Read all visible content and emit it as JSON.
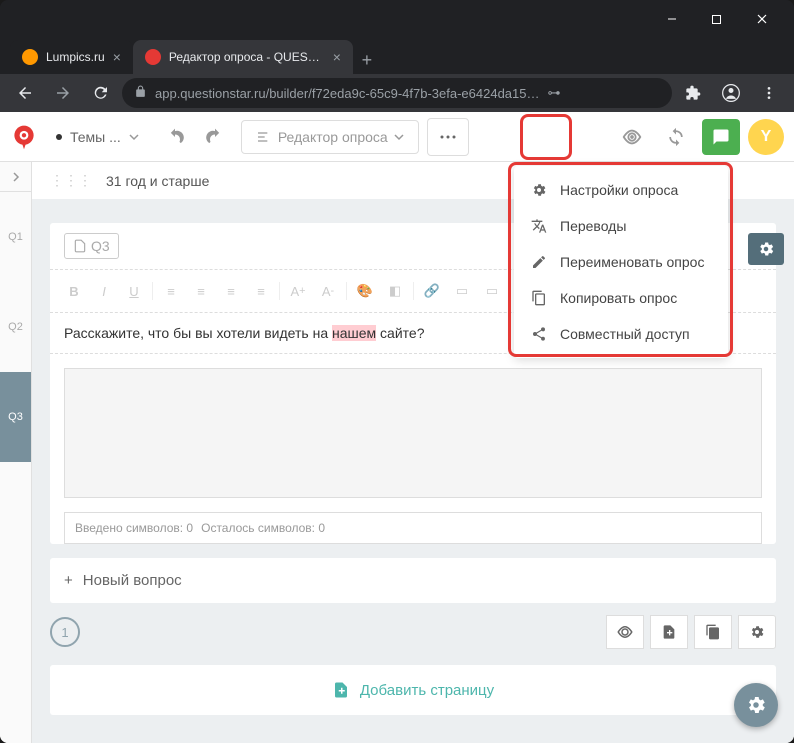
{
  "browser": {
    "tabs": [
      {
        "title": "Lumpics.ru",
        "favicon": "#ff9800"
      },
      {
        "title": "Редактор опроса - QUESTIONS",
        "favicon": "#e53935"
      }
    ],
    "url": "app.questionstar.ru/builder/f72eda9c-65c9-4f7b-3efa-e6424da15…"
  },
  "toolbar": {
    "themes_label": "Темы ...",
    "editor_label": "Редактор опроса",
    "avatar_letter": "Y"
  },
  "menu": {
    "items": [
      {
        "icon": "gear",
        "label": "Настройки опроса"
      },
      {
        "icon": "translate",
        "label": "Переводы"
      },
      {
        "icon": "pencil",
        "label": "Переименовать опрос"
      },
      {
        "icon": "copy",
        "label": "Копировать опрос"
      },
      {
        "icon": "share",
        "label": "Совместный доступ"
      }
    ]
  },
  "sidebar": {
    "items": [
      "Q1",
      "Q2",
      "Q3"
    ]
  },
  "answer_row": "31 год и старше",
  "question": {
    "badge": "Q3",
    "text_before": "Расскажите, что бы вы хотели видеть на ",
    "text_hl": "нашем",
    "text_after": " сайте?",
    "char_entered": "Введено символов: 0",
    "char_left": "Осталось символов: 0"
  },
  "new_question": "Новый вопрос",
  "page_num": "1",
  "add_page": "Добавить страницу"
}
